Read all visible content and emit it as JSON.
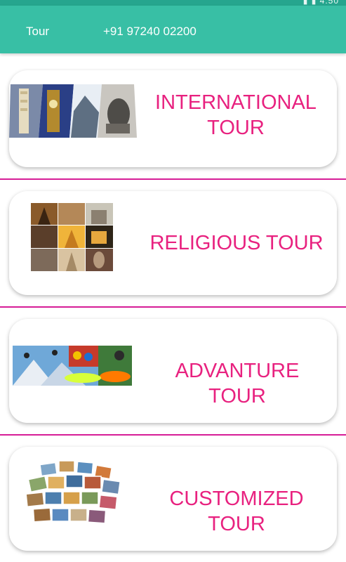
{
  "status": {
    "icons": [
      "signal-icon",
      "battery-icon"
    ],
    "time": "4:50"
  },
  "header": {
    "title": "Tour",
    "phone": "+91 97240 02200"
  },
  "colors": {
    "accent": "#38bfa5",
    "label": "#e8217f",
    "divider": "#d61d97"
  },
  "cards": [
    {
      "label_line1": "INTERNATIONAL",
      "label_line2": "TOUR",
      "image": "landmarks-collage"
    },
    {
      "label": "RELIGIOUS TOUR",
      "image": "temples-collage"
    },
    {
      "label": "ADVANTURE TOUR",
      "image": "adventure-collage"
    },
    {
      "label": "CUSTOMIZED TOUR",
      "image": "photo-stack-collage"
    }
  ]
}
